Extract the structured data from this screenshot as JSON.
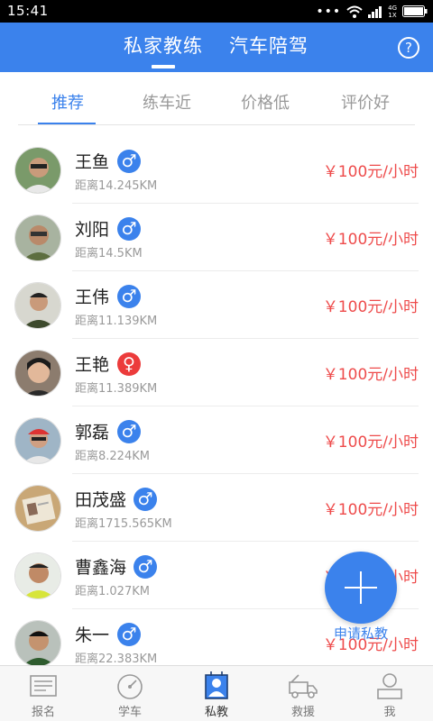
{
  "status_bar": {
    "time": "15:41",
    "network_top": "4G",
    "network_bottom": "1X"
  },
  "header": {
    "tabs": [
      {
        "label": "私家教练"
      },
      {
        "label": "汽车陪驾"
      }
    ],
    "help_label": "?"
  },
  "filters": [
    {
      "label": "推荐"
    },
    {
      "label": "练车近"
    },
    {
      "label": "价格低"
    },
    {
      "label": "评价好"
    }
  ],
  "coaches": [
    {
      "name": "王鱼",
      "gender": "♂",
      "distance": "距离14.245KM",
      "price": "￥100元/小时"
    },
    {
      "name": "刘阳",
      "gender": "♂",
      "distance": "距离14.5KM",
      "price": "￥100元/小时"
    },
    {
      "name": "王伟",
      "gender": "♂",
      "distance": "距离11.139KM",
      "price": "￥100元/小时"
    },
    {
      "name": "王艳",
      "gender": "♀",
      "distance": "距离11.389KM",
      "price": "￥100元/小时"
    },
    {
      "name": "郭磊",
      "gender": "♂",
      "distance": "距离8.224KM",
      "price": "￥100元/小时"
    },
    {
      "name": "田茂盛",
      "gender": "♂",
      "distance": "距离1715.565KM",
      "price": "￥100元/小时"
    },
    {
      "name": "曹鑫海",
      "gender": "♂",
      "distance": "距离1.027KM",
      "price": "￥100元/小时"
    },
    {
      "name": "朱一",
      "gender": "♂",
      "distance": "距离22.383KM",
      "price": "￥100元/小时"
    }
  ],
  "fab": {
    "label": "申请私教"
  },
  "bottom_nav": [
    {
      "label": "报名",
      "icon": "register-icon"
    },
    {
      "label": "学车",
      "icon": "dashboard-icon"
    },
    {
      "label": "私教",
      "icon": "coach-icon"
    },
    {
      "label": "救援",
      "icon": "tow-truck-icon"
    },
    {
      "label": "我",
      "icon": "profile-icon"
    }
  ],
  "colors": {
    "brand": "#3b82ec",
    "price": "#ee4b4b",
    "female": "#ec3b3b"
  }
}
